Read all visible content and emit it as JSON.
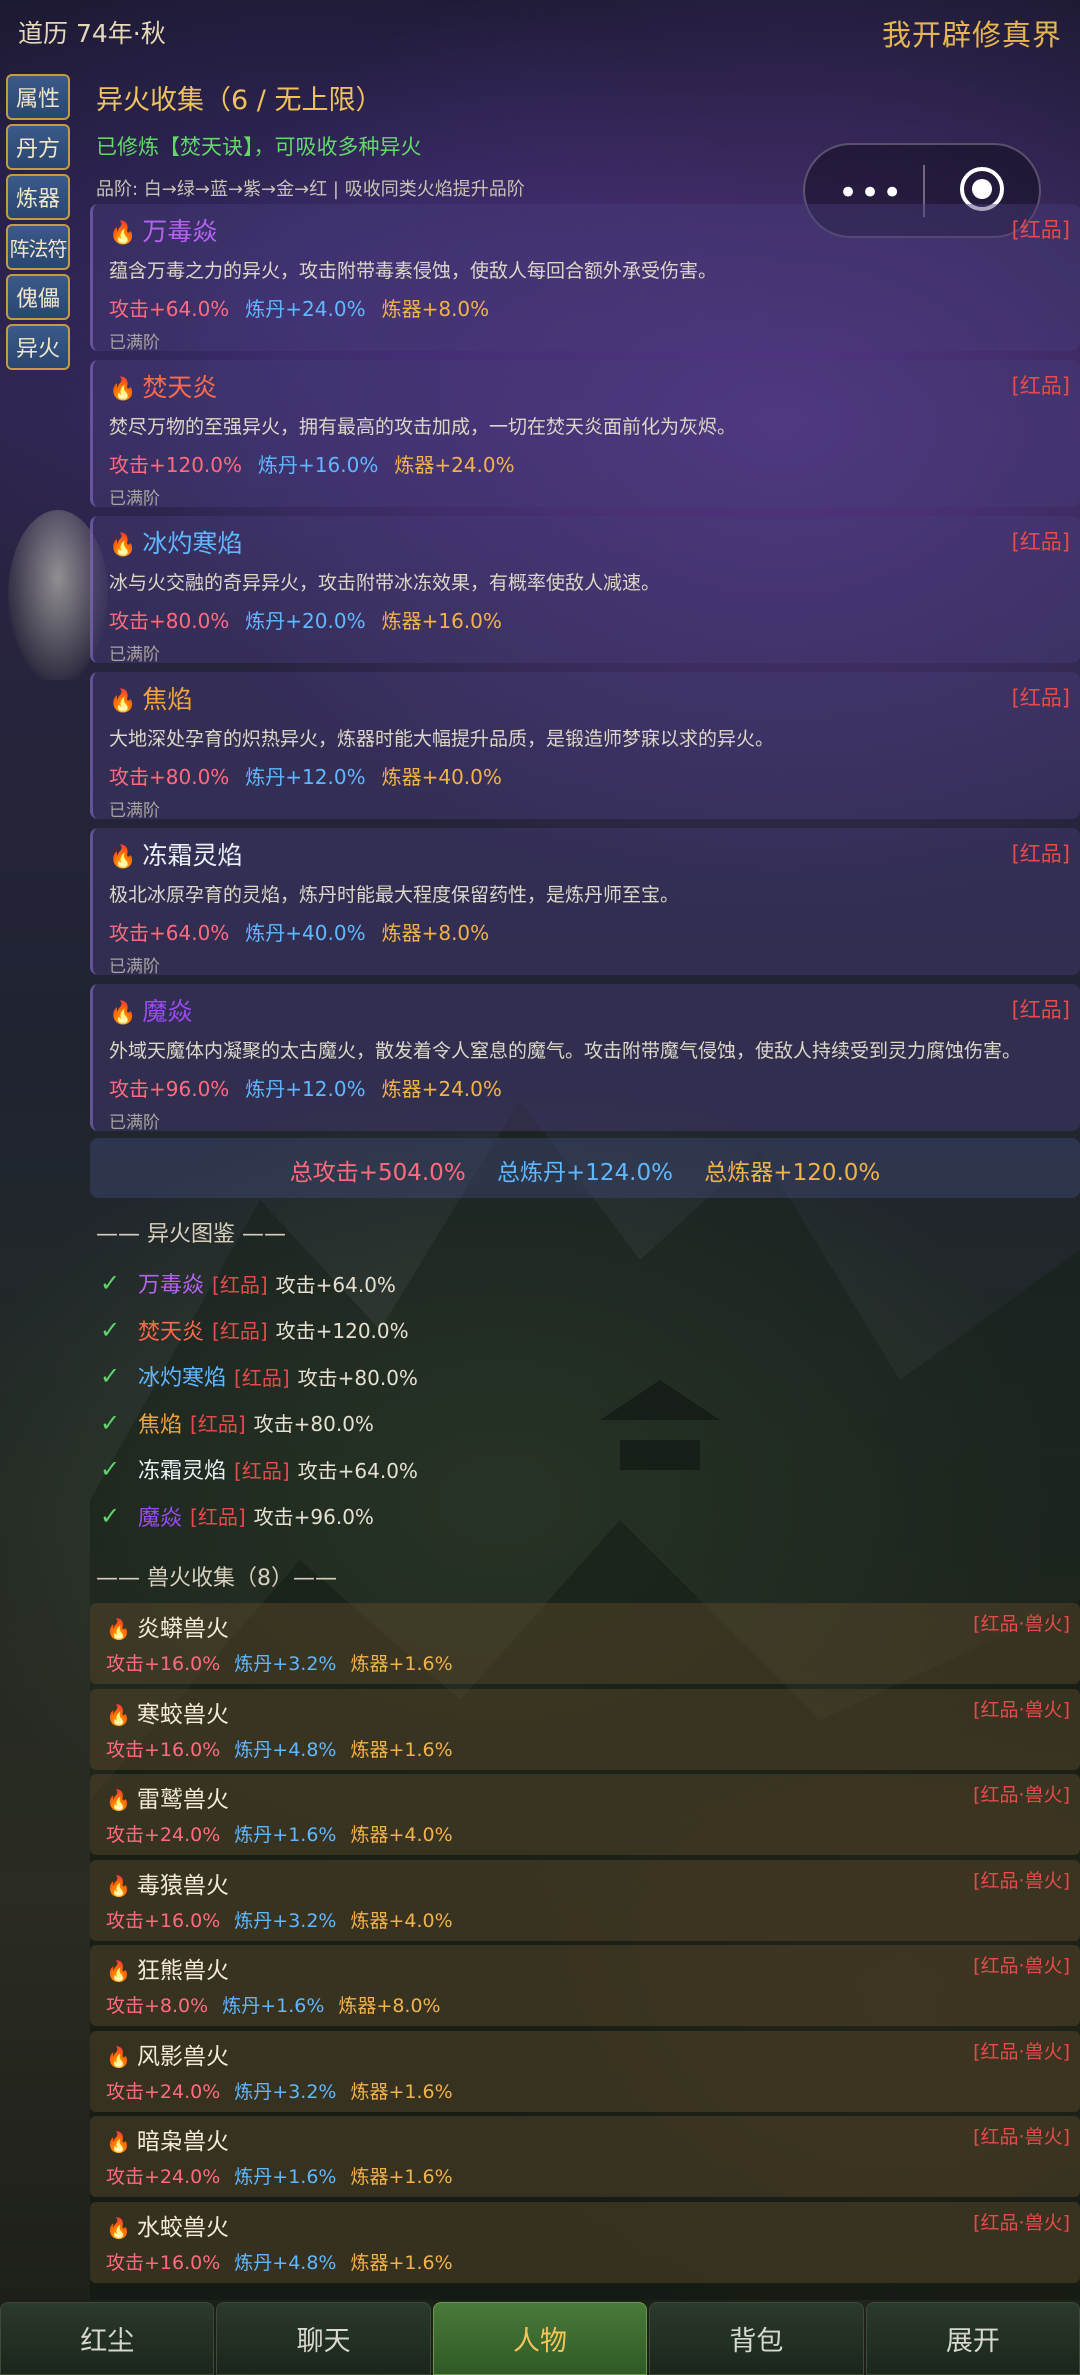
{
  "header_bar": {
    "era": "道历 74年·秋",
    "title": "我开辟修真界"
  },
  "sidebar": {
    "items": [
      {
        "label": "属性"
      },
      {
        "label": "丹方"
      },
      {
        "label": "炼器"
      },
      {
        "label": "阵法符"
      },
      {
        "label": "傀儡"
      },
      {
        "label": "异火"
      }
    ]
  },
  "capsule": {
    "more": "•••"
  },
  "section": {
    "title": "异火收集（6 / 无上限）",
    "cultivation": "已修炼【焚天诀】，可吸收多种异火",
    "grade_note": "品阶: 白→绿→蓝→紫→金→红 | 吸收同类火焰提升品阶"
  },
  "fires": [
    {
      "name": "万毒焱",
      "color": "#b463f0",
      "tag": "[红品]",
      "desc": "蕴含万毒之力的异火，攻击附带毒素侵蚀，使敌人每回合额外承受伤害。",
      "atk": "攻击+64.0%",
      "dan": "炼丹+24.0%",
      "qi": "炼器+8.0%",
      "status": "已满阶"
    },
    {
      "name": "焚天炎",
      "color": "#ff6a4a",
      "tag": "[红品]",
      "desc": "焚尽万物的至强异火，拥有最高的攻击加成，一切在焚天炎面前化为灰烬。",
      "atk": "攻击+120.0%",
      "dan": "炼丹+16.0%",
      "qi": "炼器+24.0%",
      "status": "已满阶"
    },
    {
      "name": "冰灼寒焰",
      "color": "#5fb8ff",
      "tag": "[红品]",
      "desc": "冰与火交融的奇异异火，攻击附带冰冻效果，有概率使敌人减速。",
      "atk": "攻击+80.0%",
      "dan": "炼丹+20.0%",
      "qi": "炼器+16.0%",
      "status": "已满阶"
    },
    {
      "name": "焦焰",
      "color": "#f2a23a",
      "tag": "[红品]",
      "desc": "大地深处孕育的炽热异火，炼器时能大幅提升品质，是锻造师梦寐以求的异火。",
      "atk": "攻击+80.0%",
      "dan": "炼丹+12.0%",
      "qi": "炼器+40.0%",
      "status": "已满阶"
    },
    {
      "name": "冻霜灵焰",
      "color": "#e8f0f4",
      "tag": "[红品]",
      "desc": "极北冰原孕育的灵焰，炼丹时能最大程度保留药性，是炼丹师至宝。",
      "atk": "攻击+64.0%",
      "dan": "炼丹+40.0%",
      "qi": "炼器+8.0%",
      "status": "已满阶"
    },
    {
      "name": "魔焱",
      "color": "#9a4af0",
      "tag": "[红品]",
      "desc": "外域天魔体内凝聚的太古魔火，散发着令人窒息的魔气。攻击附带魔气侵蚀，使敌人持续受到灵力腐蚀伤害。",
      "atk": "攻击+96.0%",
      "dan": "炼丹+12.0%",
      "qi": "炼器+24.0%",
      "status": "已满阶"
    }
  ],
  "totals": {
    "atk": "总攻击+504.0%",
    "dan": "总炼丹+124.0%",
    "qi": "总炼器+120.0%"
  },
  "dex": {
    "title": "—— 异火图鉴 ——",
    "items": [
      {
        "name": "万毒焱",
        "tag": "[红品]",
        "atk": "攻击+64.0%"
      },
      {
        "name": "焚天炎",
        "tag": "[红品]",
        "atk": "攻击+120.0%"
      },
      {
        "name": "冰灼寒焰",
        "tag": "[红品]",
        "atk": "攻击+80.0%"
      },
      {
        "name": "焦焰",
        "tag": "[红品]",
        "atk": "攻击+80.0%"
      },
      {
        "name": "冻霜灵焰",
        "tag": "[红品]",
        "atk": "攻击+64.0%"
      },
      {
        "name": "魔焱",
        "tag": "[红品]",
        "atk": "攻击+96.0%"
      }
    ]
  },
  "beast": {
    "title": "—— 兽火收集（8）——",
    "items": [
      {
        "name": "炎蟒兽火",
        "tag": "[红品·兽火]",
        "atk": "攻击+16.0%",
        "dan": "炼丹+3.2%",
        "qi": "炼器+1.6%"
      },
      {
        "name": "寒蛟兽火",
        "tag": "[红品·兽火]",
        "atk": "攻击+16.0%",
        "dan": "炼丹+4.8%",
        "qi": "炼器+1.6%"
      },
      {
        "name": "雷鹫兽火",
        "tag": "[红品·兽火]",
        "atk": "攻击+24.0%",
        "dan": "炼丹+1.6%",
        "qi": "炼器+4.0%"
      },
      {
        "name": "毒猿兽火",
        "tag": "[红品·兽火]",
        "atk": "攻击+16.0%",
        "dan": "炼丹+3.2%",
        "qi": "炼器+4.0%"
      },
      {
        "name": "狂熊兽火",
        "tag": "[红品·兽火]",
        "atk": "攻击+8.0%",
        "dan": "炼丹+1.6%",
        "qi": "炼器+8.0%"
      },
      {
        "name": "风影兽火",
        "tag": "[红品·兽火]",
        "atk": "攻击+24.0%",
        "dan": "炼丹+3.2%",
        "qi": "炼器+1.6%"
      },
      {
        "name": "暗枭兽火",
        "tag": "[红品·兽火]",
        "atk": "攻击+24.0%",
        "dan": "炼丹+1.6%",
        "qi": "炼器+1.6%"
      },
      {
        "name": "水蛟兽火",
        "tag": "[红品·兽火]",
        "atk": "攻击+16.0%",
        "dan": "炼丹+4.8%",
        "qi": "炼器+1.6%"
      }
    ]
  },
  "tabs": [
    {
      "label": "红尘",
      "active": false
    },
    {
      "label": "聊天",
      "active": false
    },
    {
      "label": "人物",
      "active": true
    },
    {
      "label": "背包",
      "active": false
    },
    {
      "label": "展开",
      "active": false
    }
  ],
  "colors": {
    "accent_gold": "#e4b552",
    "red_grade": "#e64a4a",
    "attack": "#ff6b7d",
    "alchemy": "#5fb8ff",
    "forging": "#f2b24a",
    "check": "#5fd46a"
  }
}
